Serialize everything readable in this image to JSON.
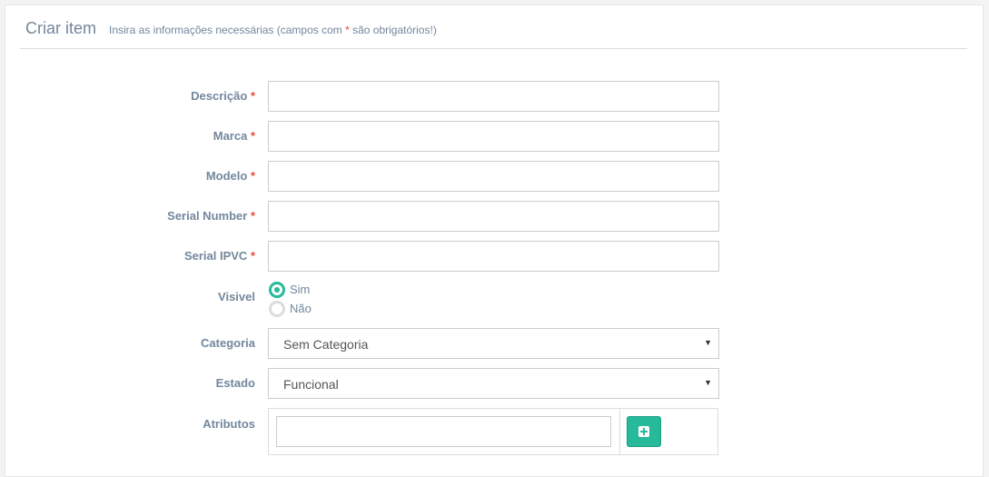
{
  "header": {
    "title": "Criar item",
    "subtitle_before": "Insira as informações necessárias (campos com ",
    "subtitle_star": "*",
    "subtitle_after": " são obrigatórios!)"
  },
  "fields": {
    "descricao": {
      "label": "Descrição",
      "required_mark": "*",
      "value": ""
    },
    "marca": {
      "label": "Marca",
      "required_mark": "*",
      "value": ""
    },
    "modelo": {
      "label": "Modelo",
      "required_mark": "*",
      "value": ""
    },
    "serial_number": {
      "label": "Serial Number",
      "required_mark": "*",
      "value": ""
    },
    "serial_ipvc": {
      "label": "Serial IPVC",
      "required_mark": "*",
      "value": ""
    },
    "visivel": {
      "label": "Visivel",
      "options": [
        {
          "label": "Sim",
          "checked": true
        },
        {
          "label": "Não",
          "checked": false
        }
      ]
    },
    "categoria": {
      "label": "Categoria",
      "selected": "Sem Categoria"
    },
    "estado": {
      "label": "Estado",
      "selected": "Funcional"
    },
    "atributos": {
      "label": "Atributos",
      "value": "",
      "add_icon": "plus-square-icon"
    }
  },
  "colors": {
    "accent": "#26b99a",
    "label": "#73879c",
    "required": "#e74c3c",
    "border": "#cccccc"
  }
}
